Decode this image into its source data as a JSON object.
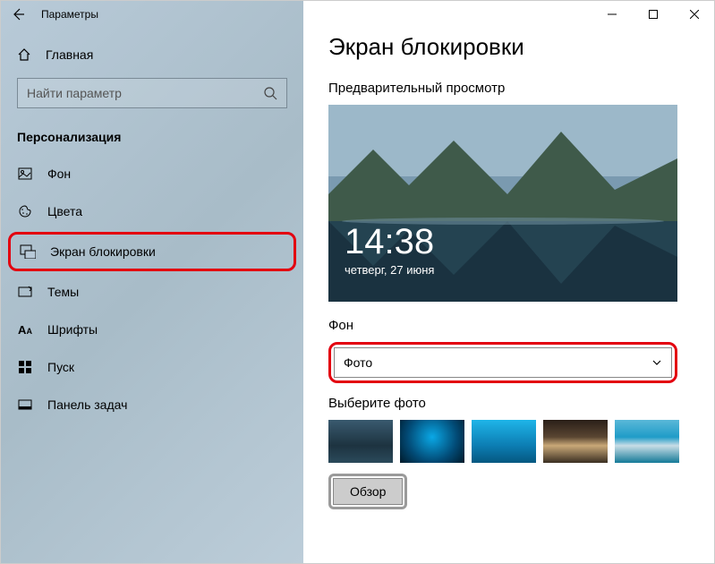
{
  "window": {
    "title": "Параметры"
  },
  "sidebar": {
    "home": "Главная",
    "search_placeholder": "Найти параметр",
    "category": "Персонализация",
    "items": [
      {
        "label": "Фон"
      },
      {
        "label": "Цвета"
      },
      {
        "label": "Экран блокировки"
      },
      {
        "label": "Темы"
      },
      {
        "label": "Шрифты"
      },
      {
        "label": "Пуск"
      },
      {
        "label": "Панель задач"
      }
    ]
  },
  "content": {
    "title": "Экран блокировки",
    "preview_label": "Предварительный просмотр",
    "preview_time": "14:38",
    "preview_date": "четверг, 27 июня",
    "background_label": "Фон",
    "background_value": "Фото",
    "choose_label": "Выберите фото",
    "browse_label": "Обзор"
  }
}
